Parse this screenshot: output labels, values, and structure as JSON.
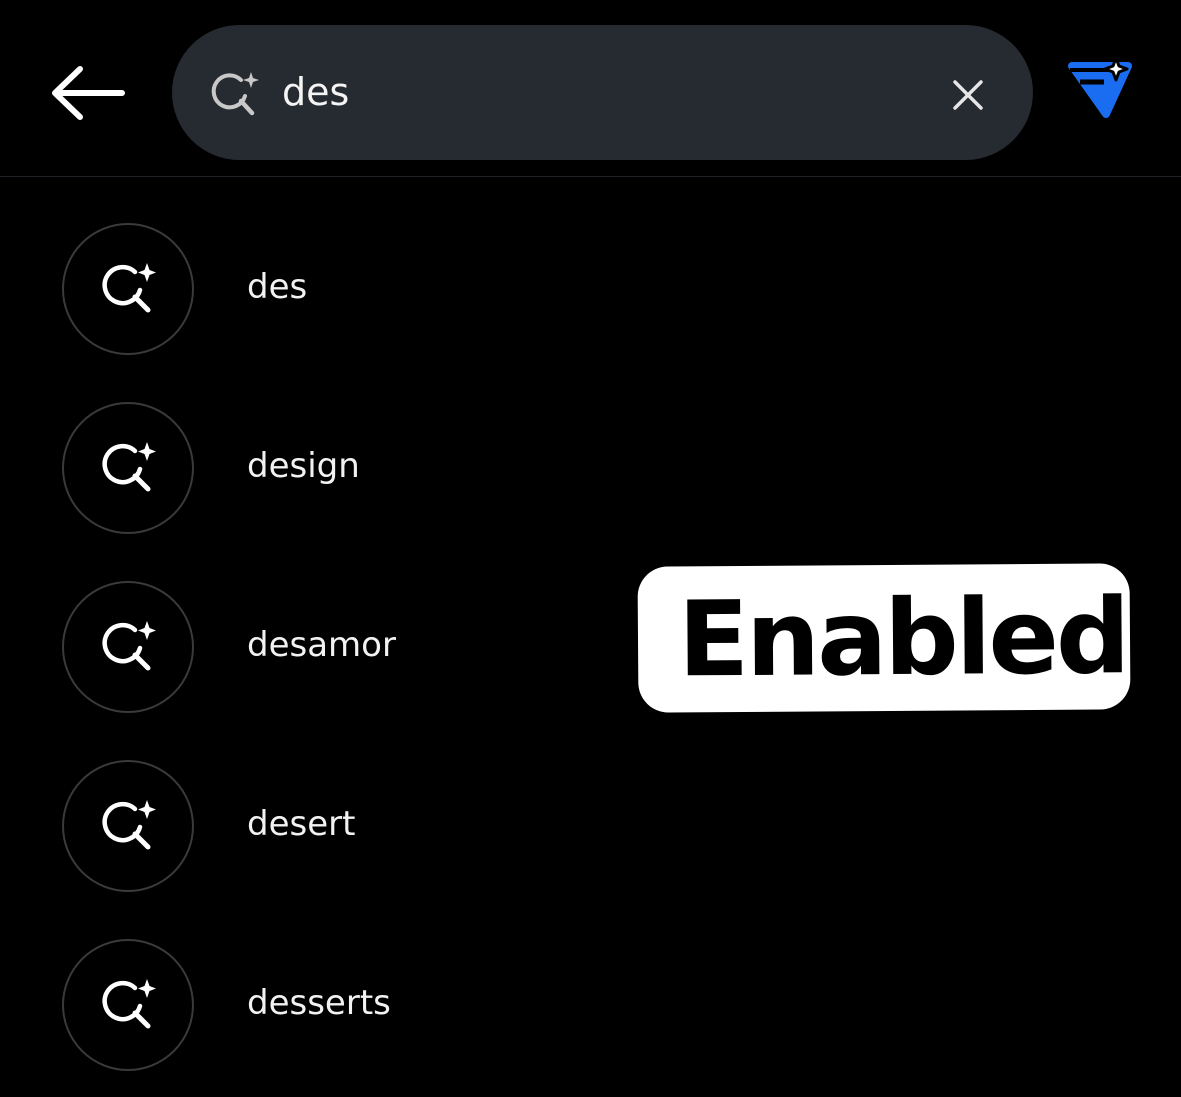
{
  "header": {
    "back_icon": "arrow-left-icon",
    "search": {
      "value": "des",
      "placeholder": "",
      "icon": "ai-search-icon",
      "clear_icon": "close-icon"
    },
    "ai_button_icon": "ai-sparkle-shield-icon",
    "accent_color": "#1a6cf0"
  },
  "suggestions": [
    {
      "label": "des",
      "icon": "ai-search-icon"
    },
    {
      "label": "design",
      "icon": "ai-search-icon"
    },
    {
      "label": "desamor",
      "icon": "ai-search-icon"
    },
    {
      "label": "desert",
      "icon": "ai-search-icon"
    },
    {
      "label": "desserts",
      "icon": "ai-search-icon"
    }
  ],
  "overlay": {
    "badge_text": "Enabled"
  }
}
